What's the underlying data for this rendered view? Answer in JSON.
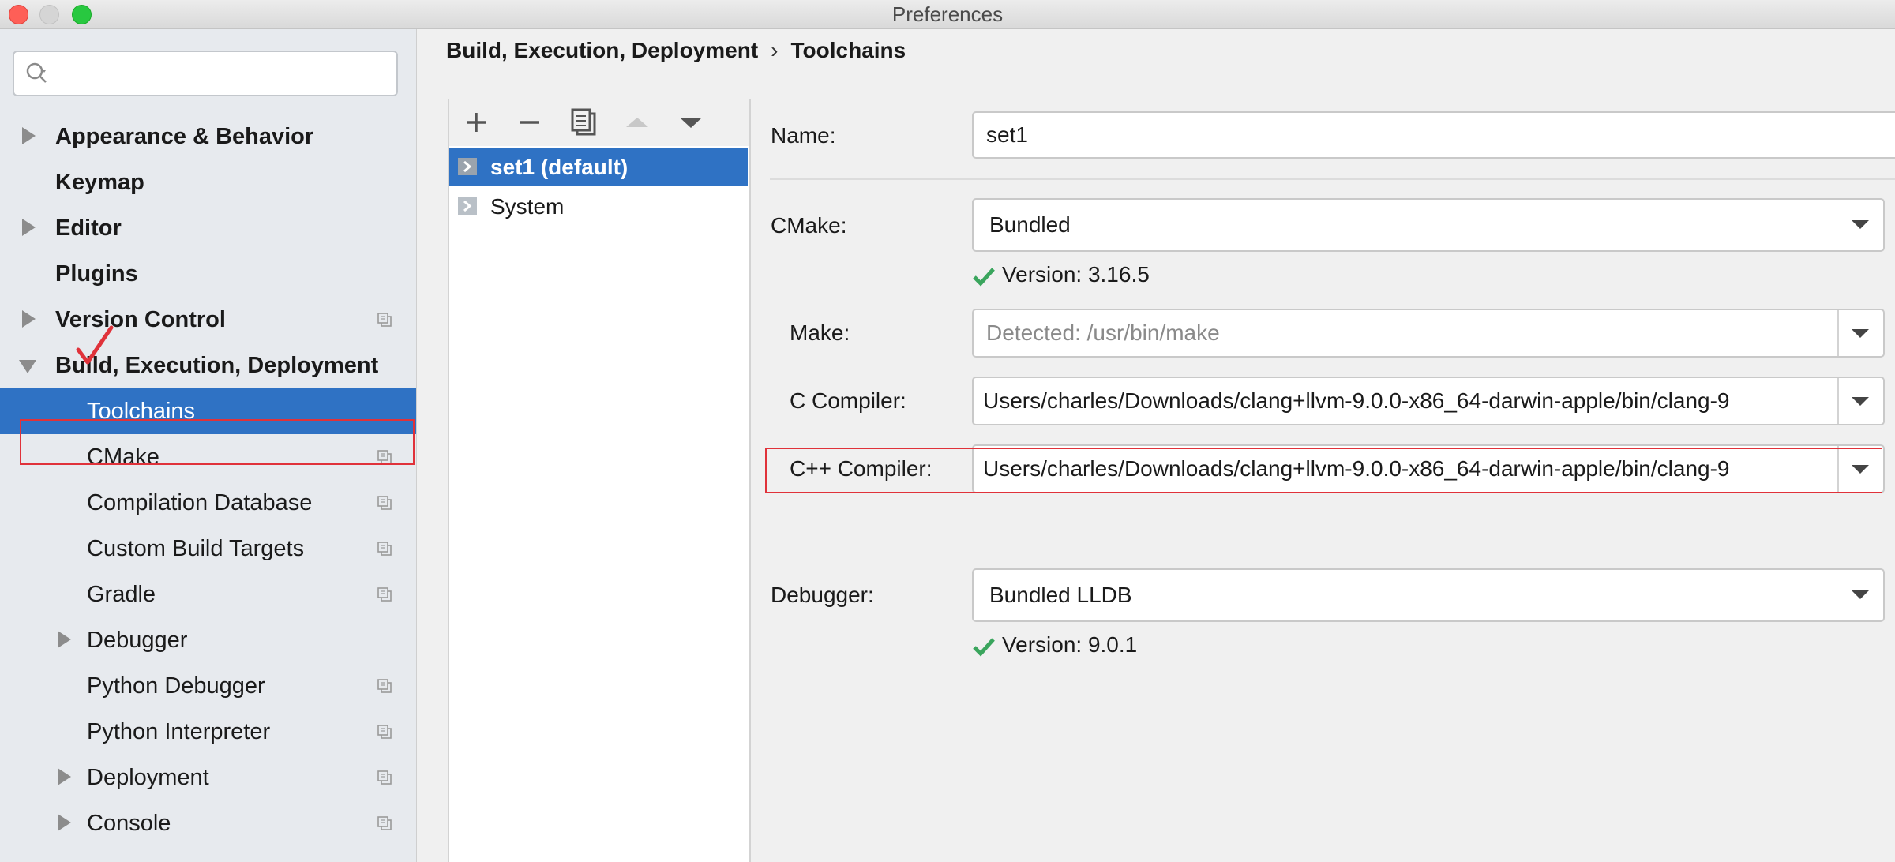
{
  "window": {
    "title": "Preferences"
  },
  "search": {
    "placeholder": ""
  },
  "sidebar": {
    "items": [
      {
        "label": "Appearance & Behavior",
        "level": 0,
        "expandable": true,
        "expanded": false
      },
      {
        "label": "Keymap",
        "level": 0,
        "expandable": false
      },
      {
        "label": "Editor",
        "level": 0,
        "expandable": true,
        "expanded": false
      },
      {
        "label": "Plugins",
        "level": 0,
        "expandable": false
      },
      {
        "label": "Version Control",
        "level": 0,
        "expandable": true,
        "expanded": false,
        "copy_icon": true
      },
      {
        "label": "Build, Execution, Deployment",
        "level": 0,
        "expandable": true,
        "expanded": true
      },
      {
        "label": "Toolchains",
        "level": 1,
        "selected": true
      },
      {
        "label": "CMake",
        "level": 1,
        "copy_icon": true
      },
      {
        "label": "Compilation Database",
        "level": 1,
        "copy_icon": true
      },
      {
        "label": "Custom Build Targets",
        "level": 1,
        "copy_icon": true
      },
      {
        "label": "Gradle",
        "level": 1,
        "copy_icon": true
      },
      {
        "label": "Debugger",
        "level": 1,
        "expandable": true
      },
      {
        "label": "Python Debugger",
        "level": 1,
        "copy_icon": true
      },
      {
        "label": "Python Interpreter",
        "level": 1,
        "copy_icon": true
      },
      {
        "label": "Deployment",
        "level": 1,
        "expandable": true,
        "copy_icon": true
      },
      {
        "label": "Console",
        "level": 1,
        "expandable": true,
        "copy_icon": true
      }
    ]
  },
  "breadcrumb": {
    "parent": "Build, Execution, Deployment",
    "separator": "›",
    "current": "Toolchains"
  },
  "toolbar": {
    "icons": [
      "add-icon",
      "remove-icon",
      "copy-icon",
      "move-up-icon",
      "move-down-icon"
    ]
  },
  "toolchains": {
    "items": [
      {
        "label": "set1 (default)",
        "selected": true
      },
      {
        "label": "System",
        "selected": false
      }
    ]
  },
  "form": {
    "name": {
      "label": "Name:",
      "value": "set1"
    },
    "cmake": {
      "label": "CMake:",
      "value": "Bundled",
      "version": "Version: 3.16.5"
    },
    "make": {
      "label": "Make:",
      "placeholder": "Detected: /usr/bin/make"
    },
    "c_compiler": {
      "label": "C Compiler:",
      "value": "Users/charles/Downloads/clang+llvm-9.0.0-x86_64-darwin-apple/bin/clang-9"
    },
    "cpp_compiler": {
      "label": "C++ Compiler:",
      "value": "Users/charles/Downloads/clang+llvm-9.0.0-x86_64-darwin-apple/bin/clang-9"
    },
    "debugger": {
      "label": "Debugger:",
      "value": "Bundled LLDB",
      "version": "Version: 9.0.1"
    }
  },
  "colors": {
    "selection": "#2f72c4",
    "annotation": "#e0323a",
    "success": "#3aa55d"
  }
}
